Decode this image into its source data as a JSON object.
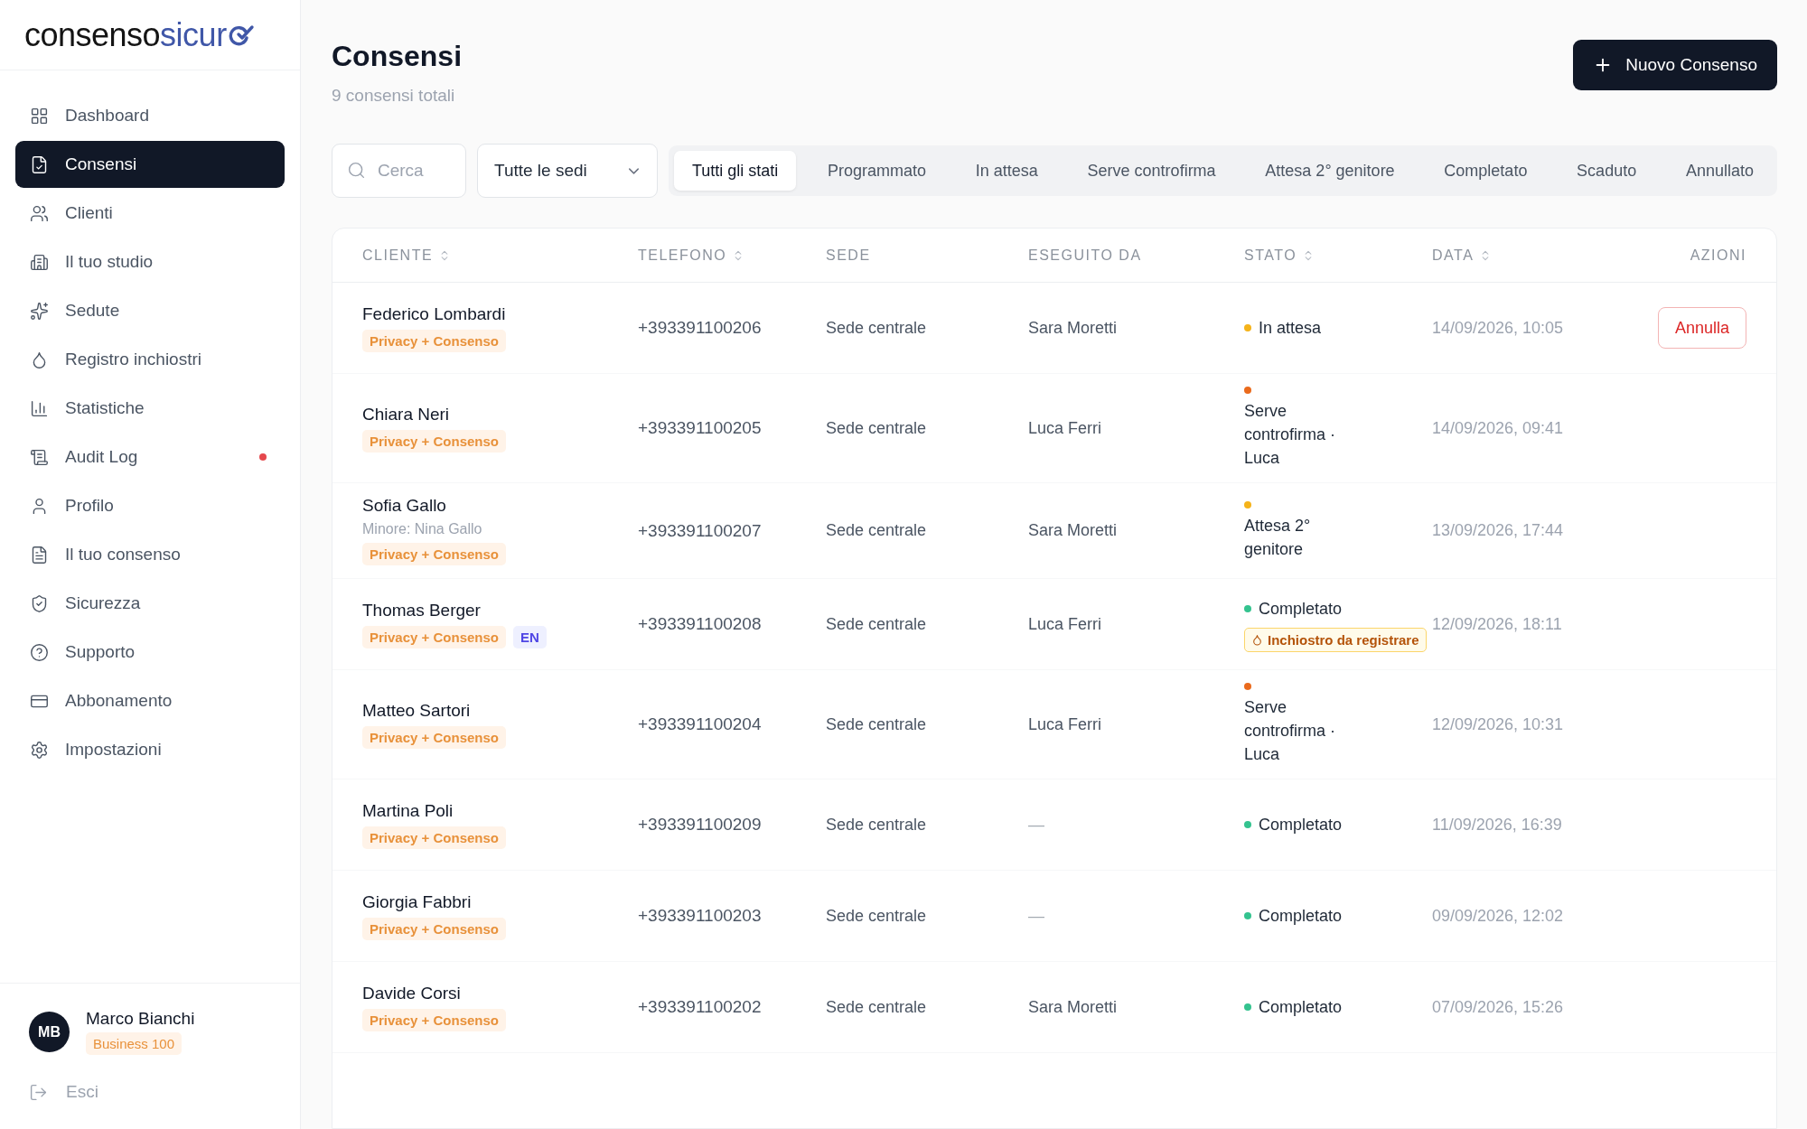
{
  "logo": {
    "text_dark": "consenso",
    "text_accent": "sicur"
  },
  "sidebar": {
    "items": [
      {
        "label": "Dashboard",
        "selected": false,
        "alert": false
      },
      {
        "label": "Consensi",
        "selected": true,
        "alert": false
      },
      {
        "label": "Clienti",
        "selected": false,
        "alert": false
      },
      {
        "label": "Il tuo studio",
        "selected": false,
        "alert": false
      },
      {
        "label": "Sedute",
        "selected": false,
        "alert": false
      },
      {
        "label": "Registro inchiostri",
        "selected": false,
        "alert": false
      },
      {
        "label": "Statistiche",
        "selected": false,
        "alert": false
      },
      {
        "label": "Audit Log",
        "selected": false,
        "alert": true
      },
      {
        "label": "Profilo",
        "selected": false,
        "alert": false
      },
      {
        "label": "Il tuo consenso",
        "selected": false,
        "alert": false
      },
      {
        "label": "Sicurezza",
        "selected": false,
        "alert": false
      },
      {
        "label": "Supporto",
        "selected": false,
        "alert": false
      },
      {
        "label": "Abbonamento",
        "selected": false,
        "alert": false
      },
      {
        "label": "Impostazioni",
        "selected": false,
        "alert": false
      }
    ],
    "user": {
      "initials": "MB",
      "name": "Marco Bianchi",
      "plan": "Business 100"
    },
    "logout": "Esci"
  },
  "header": {
    "title": "Consensi",
    "subtitle": "9 consensi totali",
    "new_button": "Nuovo Consenso"
  },
  "filters": {
    "search": {
      "placeholder": "Cerca"
    },
    "site_select": {
      "value": "Tutte le sedi"
    },
    "status_tabs": [
      {
        "label": "Tutti gli stati",
        "selected": true
      },
      {
        "label": "Programmato",
        "selected": false
      },
      {
        "label": "In attesa",
        "selected": false
      },
      {
        "label": "Serve controfirma",
        "selected": false
      },
      {
        "label": "Attesa 2° genitore",
        "selected": false
      },
      {
        "label": "Completato",
        "selected": false
      },
      {
        "label": "Scaduto",
        "selected": false
      },
      {
        "label": "Annullato",
        "selected": false
      }
    ]
  },
  "table": {
    "columns": [
      {
        "label": "CLIENTE",
        "sortable": true
      },
      {
        "label": "TELEFONO",
        "sortable": true
      },
      {
        "label": "SEDE",
        "sortable": false
      },
      {
        "label": "ESEGUITO DA",
        "sortable": false
      },
      {
        "label": "STATO",
        "sortable": true
      },
      {
        "label": "DATA",
        "sortable": true
      },
      {
        "label": "AZIONI",
        "sortable": false
      }
    ],
    "rows": [
      {
        "client": "Federico Lombardi",
        "tags": [
          {
            "kind": "consent",
            "label": "Privacy + Consenso"
          }
        ],
        "phone": "+393391100206",
        "site": "Sede centrale",
        "performed_by": "Sara Moretti",
        "status": {
          "label": "In attesa",
          "color": "#f5b31a"
        },
        "date": "14/09/2026, 10:05",
        "action": "Annulla"
      },
      {
        "client": "Chiara Neri",
        "tags": [
          {
            "kind": "consent",
            "label": "Privacy + Consenso"
          }
        ],
        "phone": "+393391100205",
        "site": "Sede centrale",
        "performed_by": "Luca Ferri",
        "status": {
          "label": "Serve controfirma · Luca",
          "color": "#ea6a1c"
        },
        "date": "14/09/2026, 09:41"
      },
      {
        "client": "Sofia Gallo",
        "minor": "Minore: Nina Gallo",
        "tags": [
          {
            "kind": "consent",
            "label": "Privacy + Consenso"
          }
        ],
        "phone": "+393391100207",
        "site": "Sede centrale",
        "performed_by": "Sara Moretti",
        "status": {
          "label": "Attesa 2° genitore",
          "color": "#f5b31a"
        },
        "date": "13/09/2026, 17:44"
      },
      {
        "client": "Thomas Berger",
        "tags": [
          {
            "kind": "consent",
            "label": "Privacy + Consenso"
          },
          {
            "kind": "language",
            "label": "EN"
          }
        ],
        "phone": "+393391100208",
        "site": "Sede centrale",
        "performed_by": "Luca Ferri",
        "status": {
          "label": "Completato",
          "color": "#34c38f",
          "note": "Inchiostro da registrare"
        },
        "date": "12/09/2026, 18:11"
      },
      {
        "client": "Matteo Sartori",
        "tags": [
          {
            "kind": "consent",
            "label": "Privacy + Consenso"
          }
        ],
        "phone": "+393391100204",
        "site": "Sede centrale",
        "performed_by": "Luca Ferri",
        "status": {
          "label": "Serve controfirma · Luca",
          "color": "#ea6a1c"
        },
        "date": "12/09/2026, 10:31"
      },
      {
        "client": "Martina Poli",
        "tags": [
          {
            "kind": "consent",
            "label": "Privacy + Consenso"
          }
        ],
        "phone": "+393391100209",
        "site": "Sede centrale",
        "performed_by": "—",
        "status": {
          "label": "Completato",
          "color": "#34c38f"
        },
        "date": "11/09/2026, 16:39"
      },
      {
        "client": "Giorgia Fabbri",
        "tags": [
          {
            "kind": "consent",
            "label": "Privacy + Consenso"
          }
        ],
        "phone": "+393391100203",
        "site": "Sede centrale",
        "performed_by": "—",
        "status": {
          "label": "Completato",
          "color": "#34c38f"
        },
        "date": "09/09/2026, 12:02"
      },
      {
        "client": "Davide Corsi",
        "tags": [
          {
            "kind": "consent",
            "label": "Privacy + Consenso"
          }
        ],
        "phone": "+393391100202",
        "site": "Sede centrale",
        "performed_by": "Sara Moretti",
        "status": {
          "label": "Completato",
          "color": "#34c38f"
        },
        "date": "07/09/2026, 15:26"
      }
    ]
  }
}
